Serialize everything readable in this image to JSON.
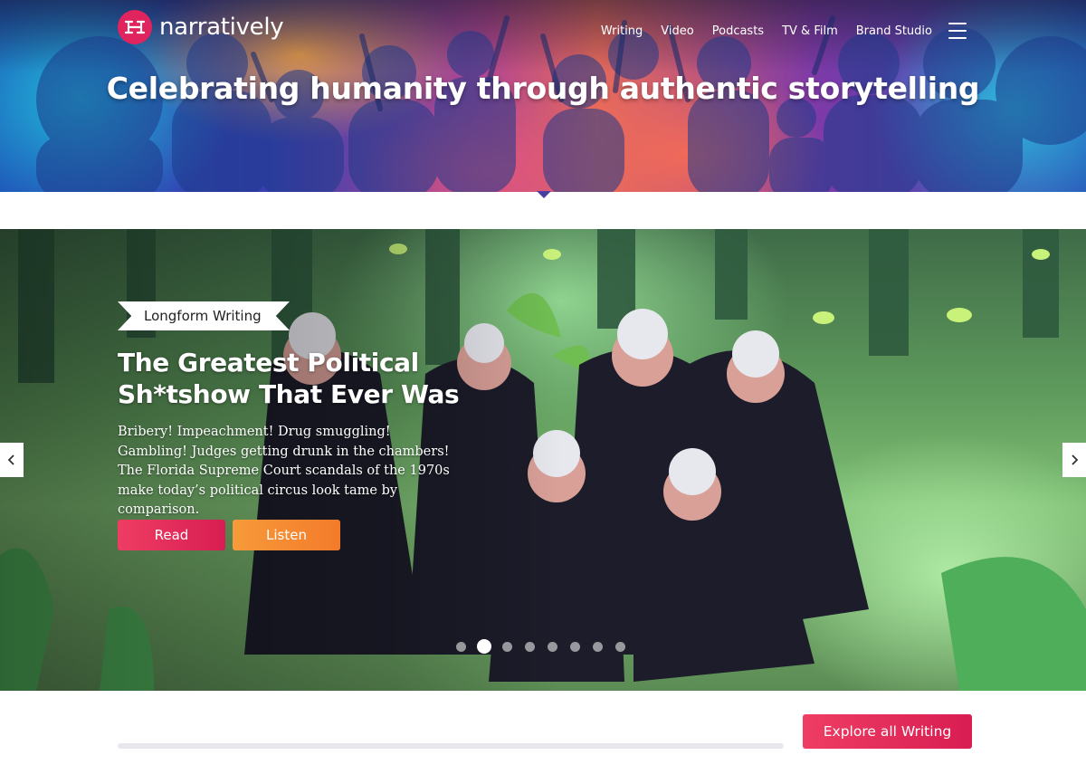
{
  "brand": {
    "name": "narratively",
    "accent": "#e0245e"
  },
  "nav": {
    "items": [
      "Writing",
      "Video",
      "Podcasts",
      "TV & Film",
      "Brand Studio"
    ],
    "menu_icon": "hamburger-icon"
  },
  "hero": {
    "tagline": "Celebrating humanity through authentic storytelling"
  },
  "feature": {
    "category": "Longform Writing",
    "title": "The Greatest Political Sh*tshow That Ever Was",
    "dek": "Bribery! Impeachment! Drug smuggling! Gambling! Judges getting drunk in the chambers! The Florida Supreme Court scandals of the 1970s make today’s political circus look tame by comparison.",
    "read_label": "Read",
    "listen_label": "Listen",
    "prev_icon": "chevron-left-icon",
    "next_icon": "chevron-right-icon",
    "slide_count": 8,
    "active_slide": 2
  },
  "section": {
    "explore_label": "Explore all Writing"
  },
  "colors": {
    "read": "#e0245e",
    "listen": "#f58a33",
    "explore": "#e0245e"
  }
}
